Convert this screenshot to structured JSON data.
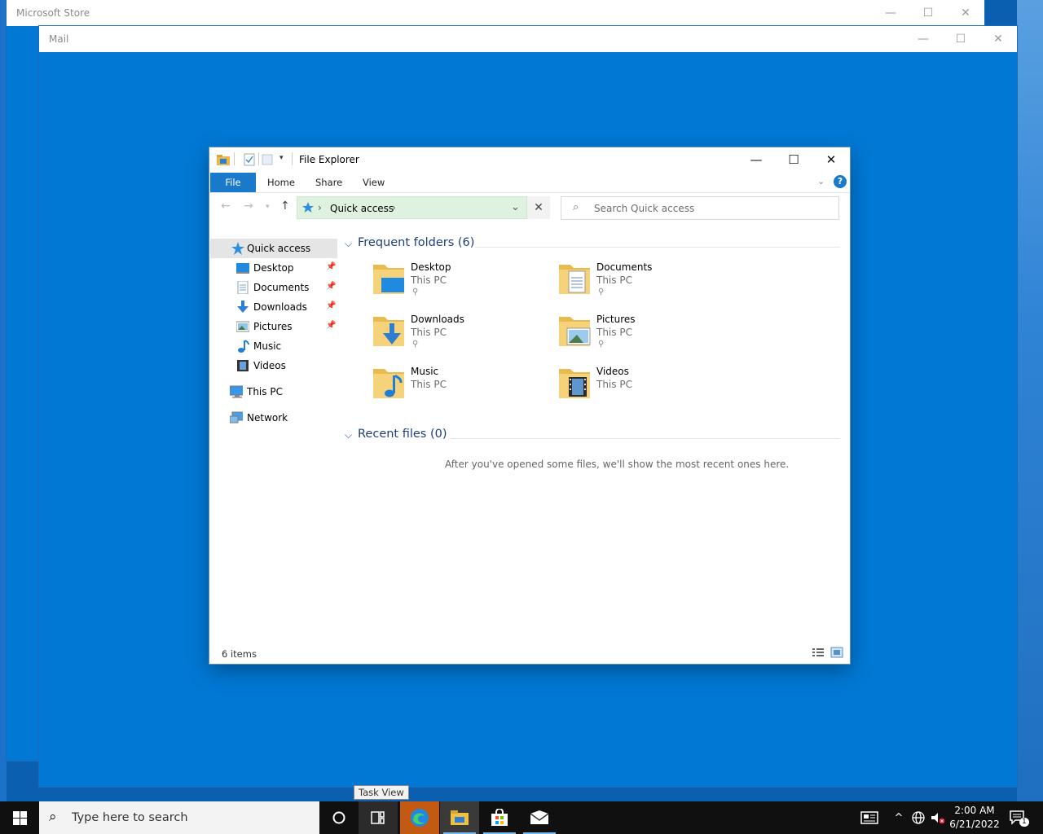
{
  "background_windows": {
    "store_title": "Microsoft Store",
    "mail_title": "Mail"
  },
  "explorer": {
    "title": "File Explorer",
    "ribbon_tabs": [
      "File",
      "Home",
      "Share",
      "View"
    ],
    "address": {
      "location": "Quick access"
    },
    "search_placeholder": "Search Quick access",
    "nav": {
      "quick_access": "Quick access",
      "pinned": [
        {
          "label": "Desktop",
          "icon": "desktop-icon",
          "pinned": true
        },
        {
          "label": "Documents",
          "icon": "documents-icon",
          "pinned": true
        },
        {
          "label": "Downloads",
          "icon": "downloads-icon",
          "pinned": true
        },
        {
          "label": "Pictures",
          "icon": "pictures-icon",
          "pinned": true
        },
        {
          "label": "Music",
          "icon": "music-icon",
          "pinned": false
        },
        {
          "label": "Videos",
          "icon": "videos-icon",
          "pinned": false
        }
      ],
      "this_pc": "This PC",
      "network": "Network"
    },
    "frequent_folders": {
      "heading": "Frequent folders (6)",
      "items": [
        {
          "name": "Desktop",
          "location": "This PC",
          "pinned": true
        },
        {
          "name": "Documents",
          "location": "This PC",
          "pinned": true
        },
        {
          "name": "Downloads",
          "location": "This PC",
          "pinned": true
        },
        {
          "name": "Pictures",
          "location": "This PC",
          "pinned": true
        },
        {
          "name": "Music",
          "location": "This PC",
          "pinned": false
        },
        {
          "name": "Videos",
          "location": "This PC",
          "pinned": false
        }
      ]
    },
    "recent_files": {
      "heading": "Recent files (0)",
      "empty_message": "After you've opened some files, we'll show the most recent ones here."
    },
    "status_bar": {
      "item_count": "6 items"
    }
  },
  "taskbar": {
    "search_placeholder": "Type here to search",
    "tooltip": "Task View",
    "clock_time": "2:00 AM",
    "clock_date": "6/21/2022",
    "notification_count": "1"
  },
  "colors": {
    "desktop_blue": "#0078d4",
    "ribbon_file_tab": "#1979ca",
    "address_bar_bg": "#dff1df",
    "taskbar_bg": "#101010"
  }
}
